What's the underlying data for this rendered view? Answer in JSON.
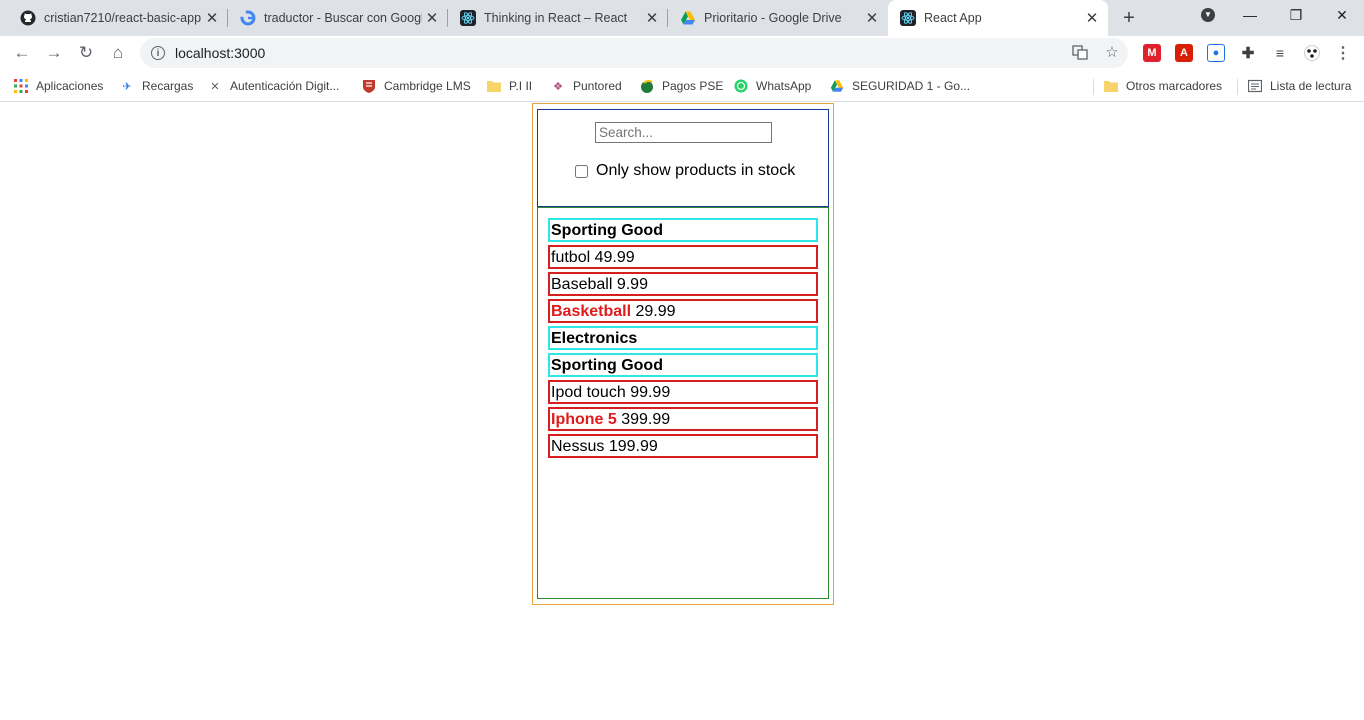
{
  "browser": {
    "tabs": [
      {
        "title": "cristian7210/react-basic-app",
        "icon": "github-icon"
      },
      {
        "title": "traductor - Buscar con Google",
        "icon": "google-icon"
      },
      {
        "title": "Thinking in React – React",
        "icon": "react-icon"
      },
      {
        "title": "Prioritario - Google Drive",
        "icon": "drive-icon"
      },
      {
        "title": "React App",
        "icon": "react-icon",
        "active": true
      }
    ],
    "url": "localhost:3000",
    "bookmarks": [
      {
        "label": "Aplicaciones",
        "icon": "apps-grid-icon"
      },
      {
        "label": "Recargas",
        "icon": "recargas-icon"
      },
      {
        "label": "Autenticación Digit...",
        "icon": "autenticacion-icon"
      },
      {
        "label": "Cambridge LMS",
        "icon": "cambridge-icon"
      },
      {
        "label": "P.I II",
        "icon": "folder-icon"
      },
      {
        "label": "Puntored",
        "icon": "puntored-icon"
      },
      {
        "label": "Pagos PSE",
        "icon": "pse-icon"
      },
      {
        "label": "WhatsApp",
        "icon": "whatsapp-icon"
      },
      {
        "label": "SEGURIDAD 1 - Go...",
        "icon": "drive-icon"
      }
    ],
    "other_bookmarks": "Otros marcadores",
    "reading_list": "Lista de lectura"
  },
  "app": {
    "search_placeholder": "Search...",
    "stock_label": "Only show products in stock",
    "rows": [
      {
        "type": "category",
        "name": "Sporting Good"
      },
      {
        "type": "product",
        "name": "futbol",
        "price": "49.99",
        "stocked": true
      },
      {
        "type": "product",
        "name": "Baseball",
        "price": "9.99",
        "stocked": true
      },
      {
        "type": "product",
        "name": "Basketball",
        "price": "29.99",
        "stocked": false
      },
      {
        "type": "category",
        "name": "Electronics"
      },
      {
        "type": "category",
        "name": "Sporting Good"
      },
      {
        "type": "product",
        "name": "Ipod touch",
        "price": "99.99",
        "stocked": true
      },
      {
        "type": "product",
        "name": "Iphone 5",
        "price": "399.99",
        "stocked": false
      },
      {
        "type": "product",
        "name": "Nessus",
        "price": "199.99",
        "stocked": true
      }
    ]
  },
  "colors": {
    "outer_border": "#e6a23c",
    "search_border": "#1f3a93",
    "table_border": "#2e8b2e",
    "category_border": "#2ee6e6",
    "product_border": "#d61f1f",
    "out_of_stock_text": "#e01b1b"
  }
}
